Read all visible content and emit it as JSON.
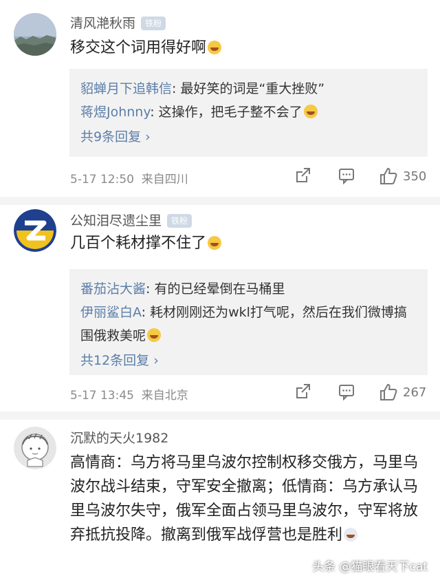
{
  "comments": [
    {
      "username": "清风滟秋雨",
      "badge": "铁粉",
      "text": "移交这个词用得好啊",
      "emoji": "laughing-tears-emoji",
      "replies": [
        {
          "name": "貂蝉月下追韩信",
          "text": ": 最好笑的词是“重大挫败”"
        },
        {
          "name": "蒋煜Johnny",
          "text": ": 这操作，把毛子整不会了"
        }
      ],
      "more_replies": "共9条回复 ›",
      "time": "5-17 12:50",
      "location": "来自四川",
      "likes": "350"
    },
    {
      "username": "公知泪尽遗尘里",
      "badge": "铁粉",
      "text": "几百个耗材撑不住了",
      "emoji": "laughing-tears-emoji",
      "replies": [
        {
          "name": "番茄沾大酱",
          "text": ": 有的已经晕倒在马桶里"
        },
        {
          "name": "伊丽鲨白A",
          "text": ": 耗材刚刚还为wkl打气呢，然后在我们微博搞围俄救美呢"
        }
      ],
      "more_replies": "共12条回复 ›",
      "time": "5-17 13:45",
      "location": "来自北京",
      "likes": "267"
    },
    {
      "username": "沉默的天火1982",
      "text": "高情商：乌方将马里乌波尔控制权移交俄方，马里乌波尔战斗结束，守军安全撤离；低情商：乌方承认马里乌波尔失守，俄军全面占领马里乌波尔，守军将放弃抵抗投降。撤离到俄军战俘营也是胜利"
    }
  ],
  "watermark": "头条 @猫眼看天下cat",
  "colors": {
    "link_blue": "#5b7ea8",
    "reply_bg": "#f2f2f2",
    "badge_bg": "#cfd9e6",
    "meta_gray": "#8a8a8a"
  }
}
